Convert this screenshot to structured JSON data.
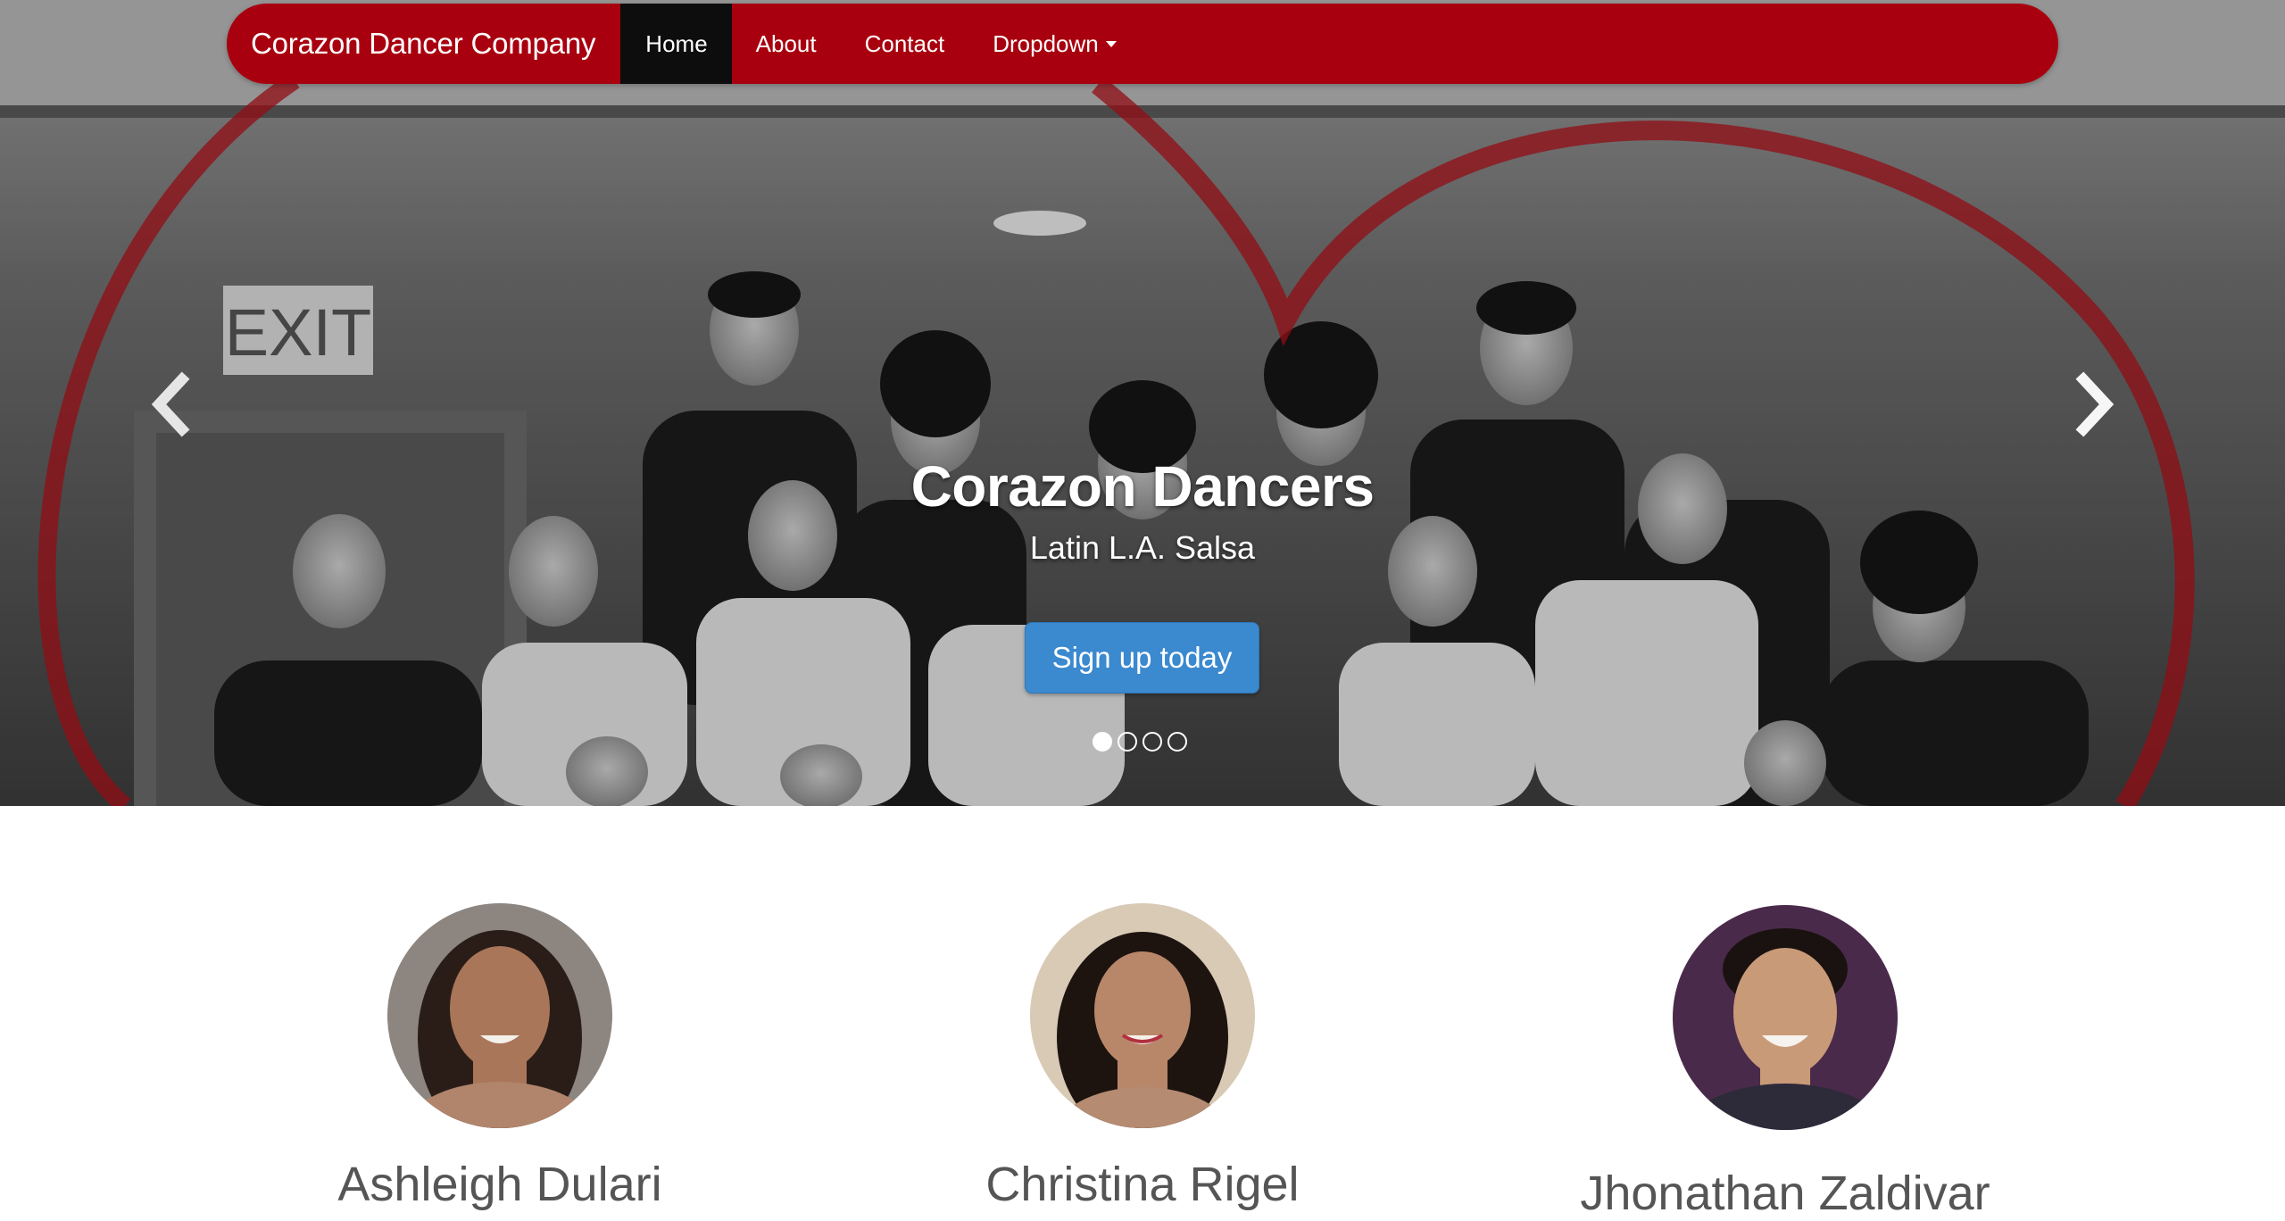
{
  "navbar": {
    "brand": "Corazon Dancer Company",
    "items": [
      {
        "label": "Home",
        "active": true
      },
      {
        "label": "About",
        "active": false
      },
      {
        "label": "Contact",
        "active": false
      },
      {
        "label": "Dropdown",
        "active": false,
        "has_caret": true
      }
    ],
    "color": "#a8000f"
  },
  "carousel": {
    "title": "Corazon Dancers",
    "subtitle": "Latin L.A. Salsa",
    "cta_label": "Sign up today",
    "cta_color": "#3b89cf",
    "slide_count": 4,
    "active_slide": 1,
    "prev_icon": "chevron-left-icon",
    "next_icon": "chevron-right-icon"
  },
  "team": {
    "members": [
      {
        "name": "Ashleigh Dulari"
      },
      {
        "name": "Christina Rigel"
      },
      {
        "name": "Jhonathan Zaldivar"
      }
    ]
  }
}
